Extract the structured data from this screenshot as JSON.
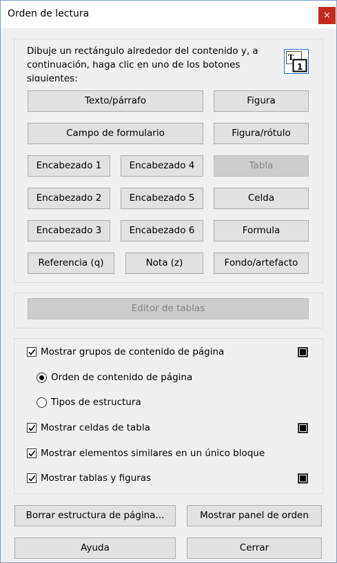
{
  "window": {
    "title": "Orden de lectura",
    "close_label": "×"
  },
  "instructions": "Dibuje un rectángulo alrededor del contenido y, a continuación, haga clic en uno de los botones siguientes:",
  "tag_buttons": {
    "texto_parrafo": "Texto/párrafo",
    "figura": "Figura",
    "campo_formulario": "Campo de formulario",
    "figura_rotulo": "Figura/rótulo",
    "encabezado_1": "Encabezado 1",
    "encabezado_4": "Encabezado 4",
    "tabla": "Tabla",
    "encabezado_2": "Encabezado 2",
    "encabezado_5": "Encabezado 5",
    "celda": "Celda",
    "encabezado_3": "Encabezado 3",
    "encabezado_6": "Encabezado 6",
    "formula": "Formula",
    "referencia": "Referencia (q)",
    "nota": "Nota (z)",
    "fondo_artefacto": "Fondo/artefacto"
  },
  "table_editor": {
    "label": "Editor de tablas",
    "enabled": false
  },
  "options": {
    "mostrar_grupos": {
      "label": "Mostrar grupos de contenido de página",
      "checked": true
    },
    "orden_contenido": {
      "label": "Orden de contenido de página",
      "selected": true
    },
    "tipos_estructura": {
      "label": "Tipos de estructura",
      "selected": false
    },
    "mostrar_celdas": {
      "label": "Mostrar celdas de tabla",
      "checked": true
    },
    "mostrar_similares": {
      "label": "Mostrar elementos similares en un único bloque",
      "checked": true
    },
    "mostrar_tablas": {
      "label": "Mostrar tablas y figuras",
      "checked": true
    }
  },
  "colors": {
    "swatch": "#000000",
    "close_button": "#c42b1c"
  },
  "footer": {
    "borrar": "Borrar estructura de página...",
    "mostrar_panel": "Mostrar panel de orden",
    "ayuda": "Ayuda",
    "cerrar": "Cerrar"
  }
}
